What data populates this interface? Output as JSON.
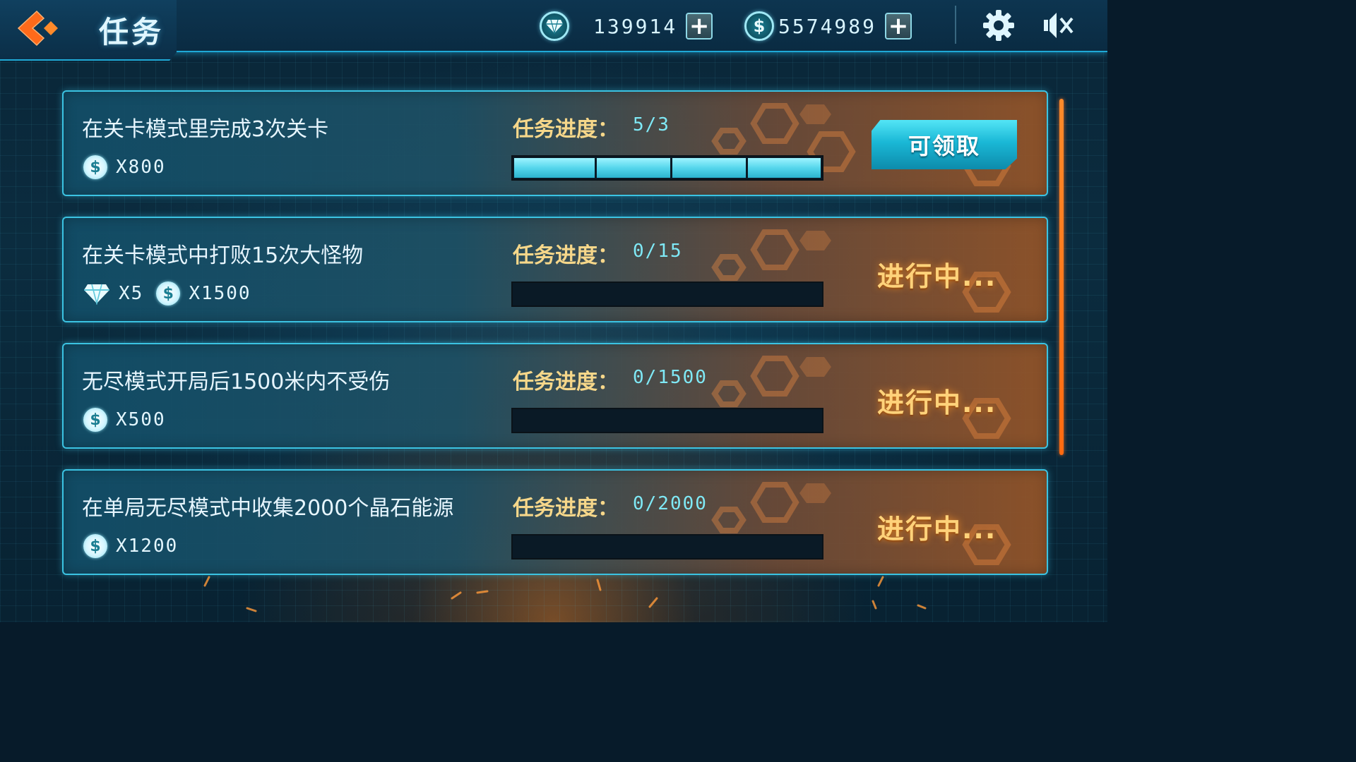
{
  "header": {
    "title": "任务",
    "diamonds": "139914",
    "coins": "5574989"
  },
  "tasks": [
    {
      "title": "在关卡模式里完成3次关卡",
      "rewards": [
        {
          "icon": "coin-icon",
          "text": "X800"
        }
      ],
      "progress_label": "任务进度：",
      "progress_value": "5/3",
      "progress_fraction": 1.0,
      "state": "claimable",
      "action_label": "可领取"
    },
    {
      "title": "在关卡模式中打败15次大怪物",
      "rewards": [
        {
          "icon": "gem-icon",
          "text": "X5"
        },
        {
          "icon": "coin-icon",
          "text": "X1500"
        }
      ],
      "progress_label": "任务进度：",
      "progress_value": "0/15",
      "progress_fraction": 0,
      "state": "in-progress",
      "action_label": "进行中..."
    },
    {
      "title": "无尽模式开局后1500米内不受伤",
      "rewards": [
        {
          "icon": "coin-icon",
          "text": "X500"
        }
      ],
      "progress_label": "任务进度：",
      "progress_value": "0/1500",
      "progress_fraction": 0,
      "state": "in-progress",
      "action_label": "进行中..."
    },
    {
      "title": "在单局无尽模式中收集2000个晶石能源",
      "rewards": [
        {
          "icon": "coin-icon",
          "text": "X1200"
        }
      ],
      "progress_label": "任务进度：",
      "progress_value": "0/2000",
      "progress_fraction": 0,
      "state": "in-progress",
      "action_label": "进行中..."
    }
  ],
  "colors": {
    "accent_cyan": "#3bc3e2",
    "progress_label": "#f6d78a",
    "status_orange": "#ffd27a",
    "scrollbar": "#ff7a20"
  }
}
